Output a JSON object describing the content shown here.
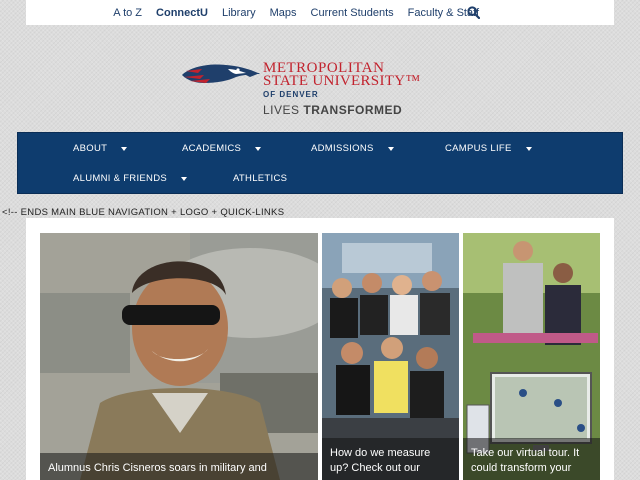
{
  "quicklinks": {
    "items": [
      {
        "label": "A to Z",
        "bold": false
      },
      {
        "label": "ConnectU",
        "bold": true
      },
      {
        "label": "Library",
        "bold": false
      },
      {
        "label": "Maps",
        "bold": false
      },
      {
        "label": "Current Students",
        "bold": false
      },
      {
        "label": "Faculty & Staff",
        "bold": false
      }
    ],
    "search_icon": "search-icon"
  },
  "logo": {
    "line1": "METROPOLITAN",
    "line2": "STATE UNIVERSITY™",
    "line3": "OF DENVER",
    "tagline_light": "LIVES ",
    "tagline_bold": "TRANSFORMED"
  },
  "nav": {
    "items": [
      {
        "label": "ABOUT",
        "dropdown": true
      },
      {
        "label": "ACADEMICS",
        "dropdown": true
      },
      {
        "label": "ADMISSIONS",
        "dropdown": true
      },
      {
        "label": "CAMPUS LIFE",
        "dropdown": true
      },
      {
        "label": "ALUMNI & FRIENDS",
        "dropdown": true
      },
      {
        "label": "ATHLETICS",
        "dropdown": false
      }
    ]
  },
  "comment": "<!-- ENDS MAIN BLUE NAVIGATION + LOGO + QUICK-LINKS",
  "features": [
    {
      "caption": "Alumnus Chris Cisneros soars in military and"
    },
    {
      "caption": "How do we measure up? Check out our"
    },
    {
      "caption": "Take our virtual tour. It could transform your"
    }
  ],
  "colors": {
    "nav_bg": "#0e3c6e",
    "brand_red": "#c2232e",
    "brand_blue": "#1f3f6b"
  }
}
